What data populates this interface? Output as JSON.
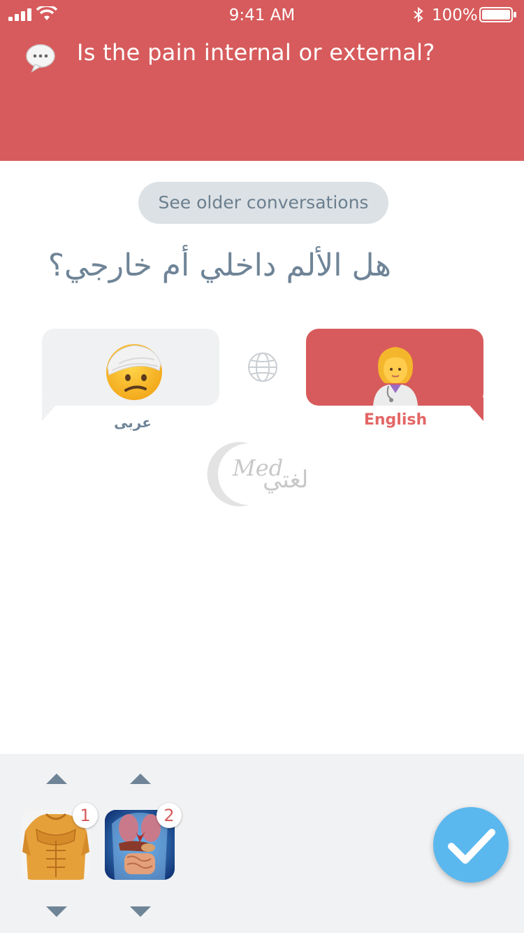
{
  "status_bar": {
    "time": "9:41 AM",
    "battery_percent": "100%",
    "icons": [
      "signal-icon",
      "wifi-icon",
      "bluetooth-icon",
      "battery-icon"
    ]
  },
  "header": {
    "question": "Is the pain internal or external?",
    "icon": "chat-bubble-icon",
    "color": "#d75b5c"
  },
  "older_conversations_label": "See older conversations",
  "translation": "هل الألم داخلي أم خارجي؟",
  "speakers": {
    "left": {
      "label": "عربى",
      "icon": "injured-face-emoji"
    },
    "right": {
      "label": "English",
      "icon": "doctor-emoji",
      "selected": true
    },
    "switch_icon": "globe-icon"
  },
  "logo": {
    "latin": "Med",
    "arabic": "لغتي"
  },
  "body_parts": [
    {
      "badge": "1",
      "icon": "torso-muscles-thumbnail"
    },
    {
      "badge": "2",
      "icon": "internal-organs-thumbnail"
    }
  ],
  "confirm_icon": "checkmark-icon",
  "colors": {
    "accent": "#d75b5c",
    "confirm": "#5bb8ee",
    "text_muted": "#6f8497"
  }
}
